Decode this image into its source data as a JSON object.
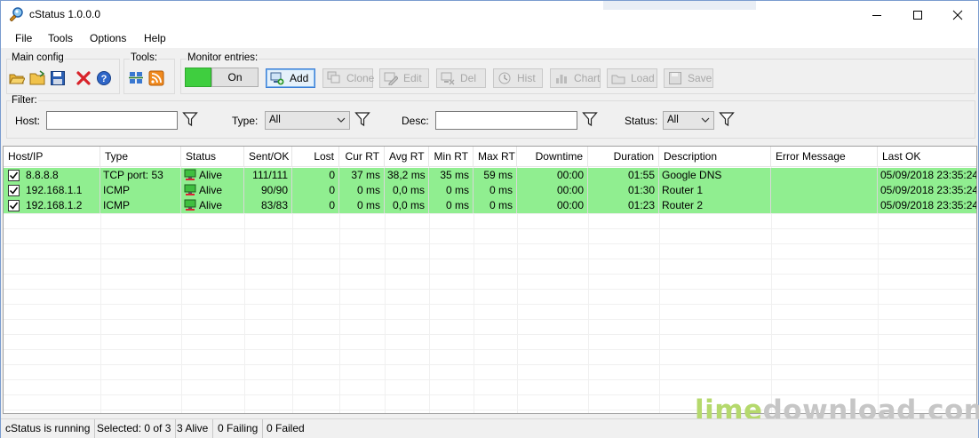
{
  "window": {
    "title": "cStatus 1.0.0.0"
  },
  "menu": [
    "File",
    "Tools",
    "Options",
    "Help"
  ],
  "groups": {
    "main_config": "Main config",
    "tools": "Tools:",
    "monitor": "Monitor entries:",
    "filter": "Filter:"
  },
  "toolbar": {
    "toggle_label": "On",
    "add": "Add",
    "clone": "Clone",
    "edit": "Edit",
    "del": "Del",
    "hist": "Hist",
    "chart": "Chart",
    "load": "Load",
    "save": "Save"
  },
  "filter": {
    "host_label": "Host:",
    "host_value": "",
    "type_label": "Type:",
    "type_value": "All",
    "desc_label": "Desc:",
    "desc_value": "",
    "status_label": "Status:",
    "status_value": "All"
  },
  "columns": [
    "Host/IP",
    "Type",
    "Status",
    "Sent/OK",
    "Lost",
    "Cur RT",
    "Avg RT",
    "Min RT",
    "Max RT",
    "Downtime",
    "Duration",
    "Description",
    "Error Message",
    "Last OK"
  ],
  "rows": [
    {
      "host": "8.8.8.8",
      "type": "TCP port: 53",
      "status": "Alive",
      "sent_ok": "111/111",
      "lost": "0",
      "cur_rt": "37 ms",
      "avg_rt": "38,2 ms",
      "min_rt": "35 ms",
      "max_rt": "59 ms",
      "downtime": "00:00",
      "duration": "01:55",
      "description": "Google DNS",
      "error": "",
      "last_ok": "05/09/2018 23:35:24"
    },
    {
      "host": "192.168.1.1",
      "type": "ICMP",
      "status": "Alive",
      "sent_ok": "90/90",
      "lost": "0",
      "cur_rt": "0 ms",
      "avg_rt": "0,0 ms",
      "min_rt": "0 ms",
      "max_rt": "0 ms",
      "downtime": "00:00",
      "duration": "01:30",
      "description": "Router 1",
      "error": "",
      "last_ok": "05/09/2018 23:35:24"
    },
    {
      "host": "192.168.1.2",
      "type": "ICMP",
      "status": "Alive",
      "sent_ok": "83/83",
      "lost": "0",
      "cur_rt": "0 ms",
      "avg_rt": "0,0 ms",
      "min_rt": "0 ms",
      "max_rt": "0 ms",
      "downtime": "00:00",
      "duration": "01:23",
      "description": "Router 2",
      "error": "",
      "last_ok": "05/09/2018 23:35:24"
    }
  ],
  "statusbar": [
    "cStatus is running",
    "Selected: 0 of 3",
    "3 Alive",
    "0 Failing",
    "0 Failed"
  ],
  "watermark": {
    "part1": "lime",
    "part2": "download.com"
  },
  "colors": {
    "alive_row": "#90ee90",
    "toggle_on": "#3fce3f",
    "accent": "#3c7fd8"
  },
  "icons": {
    "app": "magnifier-icon",
    "new": "open-folder-icon",
    "open": "folder-icon",
    "save": "floppy-icon",
    "delete": "red-x-icon",
    "help": "help-icon",
    "tool1": "network-icon",
    "tool2": "rss-icon",
    "filter": "funnel-icon",
    "status_alive": "computer-icon"
  }
}
